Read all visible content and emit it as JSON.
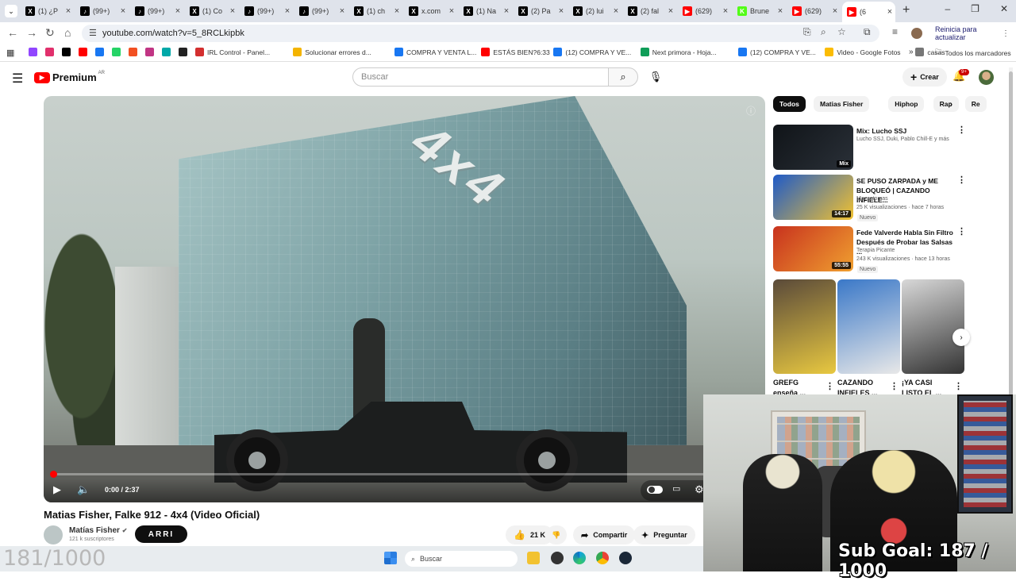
{
  "browser": {
    "tabs": [
      {
        "icon": "x-logo",
        "label": "(1) ¿P",
        "color": "#000000",
        "glyph": "X"
      },
      {
        "icon": "tiktok-logo",
        "label": "(99+)",
        "color": "#000000",
        "glyph": "♪"
      },
      {
        "icon": "tiktok-logo",
        "label": "(99+)",
        "color": "#000000",
        "glyph": "♪"
      },
      {
        "icon": "x-logo",
        "label": "(1) Co",
        "color": "#000000",
        "glyph": "X"
      },
      {
        "icon": "tiktok-logo",
        "label": "(99+)",
        "color": "#000000",
        "glyph": "♪"
      },
      {
        "icon": "tiktok-logo",
        "label": "(99+)",
        "color": "#000000",
        "glyph": "♪"
      },
      {
        "icon": "x-logo",
        "label": "(1) ch",
        "color": "#000000",
        "glyph": "X"
      },
      {
        "icon": "x-logo",
        "label": "x.com",
        "color": "#000000",
        "glyph": "X"
      },
      {
        "icon": "x-logo",
        "label": "(1) Na",
        "color": "#000000",
        "glyph": "X"
      },
      {
        "icon": "x-logo",
        "label": "(2) Pa",
        "color": "#000000",
        "glyph": "X"
      },
      {
        "icon": "x-logo",
        "label": "(2) lui",
        "color": "#000000",
        "glyph": "X"
      },
      {
        "icon": "x-logo",
        "label": "(2) fal",
        "color": "#000000",
        "glyph": "X"
      },
      {
        "icon": "youtube-logo",
        "label": "(629)",
        "color": "#ff0000",
        "glyph": "▶"
      },
      {
        "icon": "kick-logo",
        "label": "Brune",
        "color": "#53fc18",
        "glyph": "K"
      },
      {
        "icon": "youtube-logo",
        "label": "(629)",
        "color": "#ff0000",
        "glyph": "▶"
      },
      {
        "icon": "youtube-logo",
        "label": "(6",
        "color": "#ff0000",
        "glyph": "▶",
        "active": true
      }
    ],
    "url": "youtube.com/watch?v=5_8RCLkipbk",
    "update_label": "Reinicia para actualizar",
    "bookmarks": [
      {
        "label": "",
        "color": "#9146ff"
      },
      {
        "label": "",
        "color": "#e1306c"
      },
      {
        "label": "",
        "color": "#000000"
      },
      {
        "label": "",
        "color": "#ff0000"
      },
      {
        "label": "",
        "color": "#1877f2"
      },
      {
        "label": "",
        "color": "#25d366"
      },
      {
        "label": "",
        "color": "#f25022"
      },
      {
        "label": "",
        "color": "#c13584"
      },
      {
        "label": "",
        "color": "#00a8a8"
      },
      {
        "label": "",
        "color": "#222222"
      },
      {
        "label": "IRL Control - Panel...",
        "color": "#d32f2f"
      },
      {
        "label": "Solucionar errores d...",
        "color": "#f4b400"
      },
      {
        "label": "COMPRA Y VENTA L...",
        "color": "#1877f2"
      },
      {
        "label": "ESTÁS BIEN?6:33",
        "color": "#ff0000"
      },
      {
        "label": "(12) COMPRA Y VE...",
        "color": "#1877f2"
      },
      {
        "label": "Next primora - Hoja...",
        "color": "#0f9d58"
      },
      {
        "label": "(12) COMPRA Y VE...",
        "color": "#1877f2"
      },
      {
        "label": "Video - Google Fotos",
        "color": "#fbbc04"
      },
      {
        "label": "casas",
        "color": "#777777"
      }
    ],
    "all_bookmarks_label": "Todos los marcadores"
  },
  "youtube": {
    "logo_text": "Premium",
    "region": "AR",
    "search_placeholder": "Buscar",
    "create_label": "Crear",
    "notif_badge": "9+",
    "player": {
      "sign_text": "4x4",
      "time": "0:00 / 2:37",
      "progress": 0.0
    },
    "video_title": "Matias Fisher, Falke 912 - 4x4 (Video Oficial)",
    "channel_name": "Matías Fisher",
    "channel_subs": "121 k suscriptores",
    "overlay_text": "ARRI",
    "likes": "21 K",
    "share_label": "Compartir",
    "ask_label": "Preguntar",
    "chips": [
      "Todos",
      "Matias Fisher",
      "Hiphop",
      "Rap",
      "Re"
    ],
    "recommendations": [
      {
        "title": "Mix: Lucho SSJ",
        "channel": "Lucho SSJ, Duki, Pablo Chill-E y más",
        "meta": "",
        "badge": "",
        "duration": "Mix",
        "colors": [
          "#101418",
          "#2a3038"
        ]
      },
      {
        "title": "SE PUSO ZARPADA y ME BLOQUEÓ | CAZANDO INFIELE...",
        "channel": "Mazzatomas",
        "meta": "25 K visualizaciones · hace 7 horas",
        "badge": "Nuevo",
        "duration": "14:17",
        "colors": [
          "#1e5ac8",
          "#f2c230"
        ]
      },
      {
        "title": "Fede Valverde Habla Sin Filtro Después de Probar las Salsas ...",
        "channel": "Terapia Picante",
        "meta": "243 K visualizaciones · hace 13 horas",
        "badge": "Nuevo",
        "duration": "55:55",
        "colors": [
          "#c8321e",
          "#f0a030"
        ]
      }
    ],
    "shorts": [
      {
        "title": "GREFG enseña ...",
        "colors": [
          "#5a4a3a",
          "#e8c840"
        ]
      },
      {
        "title": "CAZANDO INFIELES ...",
        "colors": [
          "#3a78c8",
          "#e8e8e8"
        ]
      },
      {
        "title": "¡YA CASI LISTO EL ...",
        "colors": [
          "#d8d8d8",
          "#333333"
        ]
      }
    ]
  },
  "stream_overlay": {
    "sub_goal": "Sub Goal:  187 / 1000",
    "counter": "181/1000"
  },
  "taskbar": {
    "search_placeholder": "Buscar"
  }
}
